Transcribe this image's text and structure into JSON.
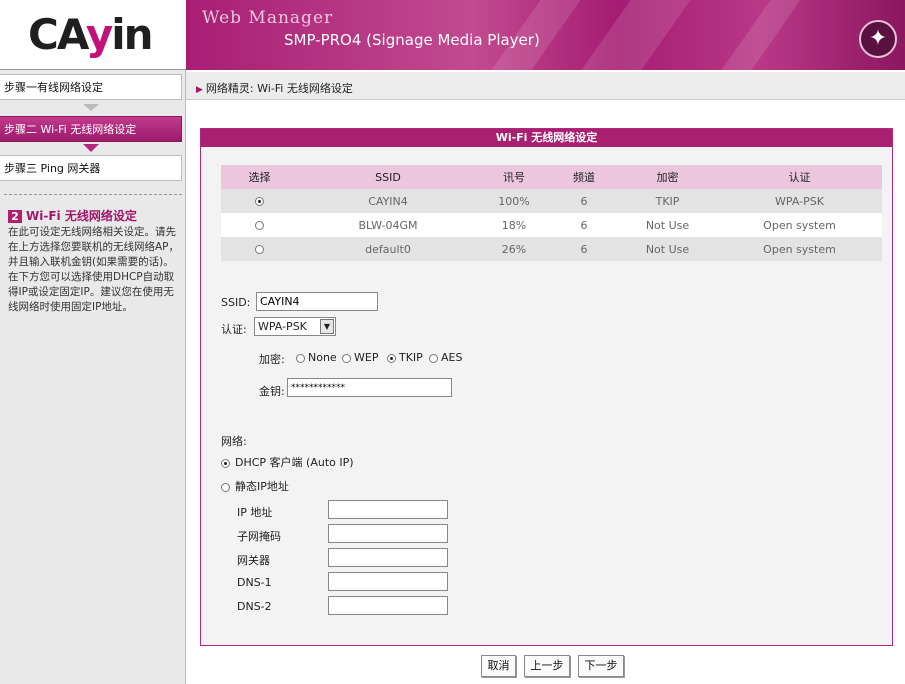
{
  "header": {
    "logo_text_left": "CA",
    "logo_text_mid": "y",
    "logo_text_right": "in",
    "app_title": "Web Manager",
    "device_title": "SMP-PRO4 (Signage Media Player)"
  },
  "sidebar": {
    "steps": [
      {
        "label": "步骤一有线网络设定"
      },
      {
        "label": "步骤二 Wi-Fi 无线网络设定"
      },
      {
        "label": "步骤三 Ping 网关器"
      }
    ],
    "help_number": "2",
    "help_title": "Wi-Fi 无线网络设定",
    "help_text": "在此可设定无线网络相关设定。请先在上方选择您要联机的无线网络AP，并且输入联机金钥(如果需要的话)。在下方您可以选择使用DHCP自动取得IP或设定固定IP。建议您在使用无线网络时使用固定IP地址。"
  },
  "breadcrumb": "网络精灵: Wi-Fi 无线网络设定",
  "panel": {
    "title": "Wi-Fi 无线网络设定",
    "table": {
      "headers": [
        "选择",
        "SSID",
        "讯号",
        "频道",
        "加密",
        "认证"
      ],
      "rows": [
        {
          "selected": true,
          "ssid": "CAYIN4",
          "signal": "100%",
          "channel": "6",
          "encryption": "TKIP",
          "auth": "WPA-PSK"
        },
        {
          "selected": false,
          "ssid": "BLW-04GM",
          "signal": "18%",
          "channel": "6",
          "encryption": "Not Use",
          "auth": "Open system"
        },
        {
          "selected": false,
          "ssid": "default0",
          "signal": "26%",
          "channel": "6",
          "encryption": "Not Use",
          "auth": "Open system"
        }
      ]
    },
    "ssid_label": "SSID:",
    "ssid_value": "CAYIN4",
    "auth_label": "认证:",
    "auth_value": "WPA-PSK",
    "enc_label": "加密:",
    "enc_options": [
      "None",
      "WEP",
      "TKIP",
      "AES"
    ],
    "enc_selected": "TKIP",
    "key_label": "金钥:",
    "key_value": "************",
    "network_label": "网络:",
    "dhcp_label": "DHCP 客户端 (Auto IP)",
    "static_label": "静态IP地址",
    "ip_fields": [
      {
        "label": "IP 地址",
        "value": ""
      },
      {
        "label": "子网掩码",
        "value": ""
      },
      {
        "label": "网关器",
        "value": ""
      },
      {
        "label": "DNS-1",
        "value": ""
      },
      {
        "label": "DNS-2",
        "value": ""
      }
    ]
  },
  "buttons": {
    "cancel": "取消",
    "prev": "上一步",
    "next": "下一步"
  },
  "colors": {
    "accent": "#a8206f",
    "header_pink": "#ecc6dd"
  }
}
